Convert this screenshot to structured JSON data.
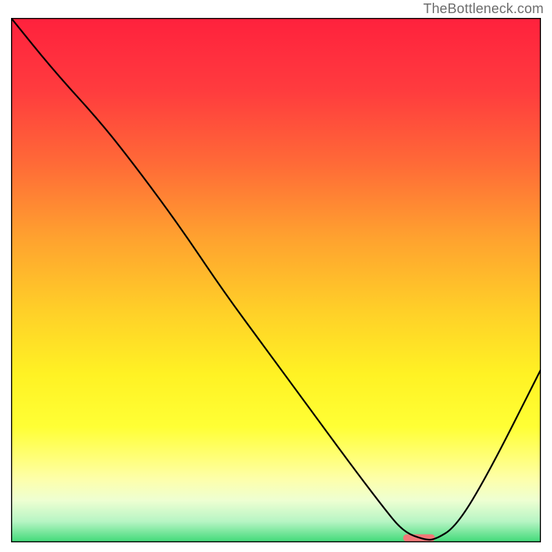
{
  "watermark": "TheBottleneck.com",
  "chart_data": {
    "type": "line",
    "title": "",
    "xlabel": "",
    "ylabel": "",
    "xlim": [
      0,
      100
    ],
    "ylim": [
      0,
      100
    ],
    "grid": false,
    "legend": false,
    "gradient_stops": [
      {
        "offset": 0,
        "color": "#ff213d"
      },
      {
        "offset": 14,
        "color": "#ff3c3e"
      },
      {
        "offset": 28,
        "color": "#ff6b37"
      },
      {
        "offset": 42,
        "color": "#ffa22f"
      },
      {
        "offset": 56,
        "color": "#ffd028"
      },
      {
        "offset": 68,
        "color": "#fff224"
      },
      {
        "offset": 78,
        "color": "#ffff35"
      },
      {
        "offset": 84,
        "color": "#ffff7a"
      },
      {
        "offset": 88,
        "color": "#fdffab"
      },
      {
        "offset": 92,
        "color": "#eeffd2"
      },
      {
        "offset": 96,
        "color": "#b7f5c4"
      },
      {
        "offset": 100,
        "color": "#3ed977"
      }
    ],
    "series": [
      {
        "name": "bottleneck-curve",
        "color": "#000000",
        "x": [
          0,
          8,
          17,
          24,
          32,
          40,
          48,
          56,
          64,
          70,
          74,
          78,
          80,
          84,
          90,
          100
        ],
        "values": [
          100,
          90,
          80,
          71,
          60,
          48,
          37,
          26,
          15,
          7,
          2,
          0.5,
          0.5,
          3,
          13,
          33
        ]
      }
    ],
    "marker": {
      "x_center": 77,
      "x_half_width": 3,
      "color": "#f27878",
      "thickness_pct": 1.4
    }
  }
}
